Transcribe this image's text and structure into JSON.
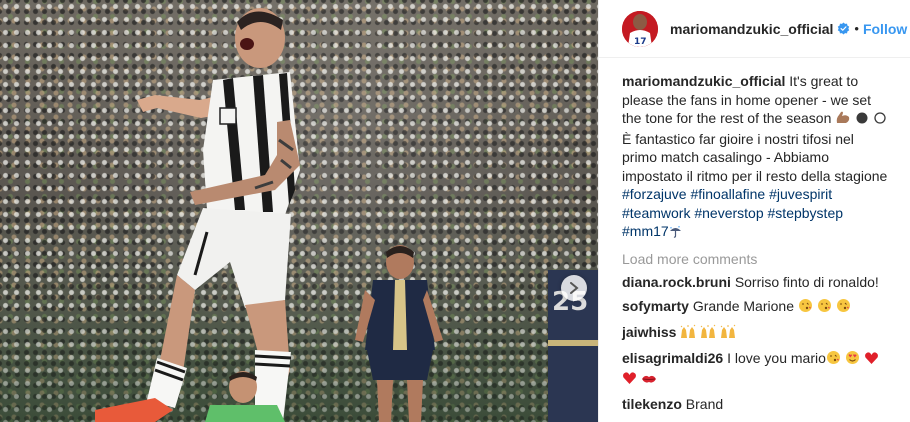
{
  "post": {
    "account": {
      "username": "mariomandzukic_official",
      "verified": true,
      "separator": "•",
      "follow_label": "Follow",
      "avatar_jersey_number": "17"
    },
    "photo": {
      "player_jersey_number": "25",
      "carousel_next_icon": "chevron-right-icon"
    },
    "caption": {
      "username": "mariomandzukic_official",
      "text_en": "It's great to please the fans in home opener - we set the tone for the rest of the season",
      "text_en_emojis": [
        "flexed-biceps",
        "black-circle",
        "white-circle"
      ],
      "text_it": "È fantastico far gioire i nostri tifosi nel primo match casalingo - Abbiamo impostato il ritmo per il resto della stagione",
      "hashtags_line1": "#forzajuve #finoallafine #juvespirit",
      "hashtags_line2": "#teamwork #neverstop #stepbystep",
      "hashtags_line3": "#mm17",
      "hashtags_line3_emoji": "umbrella-rain"
    },
    "load_more_label": "Load more comments",
    "comments": [
      {
        "username": "diana.rock.bruni",
        "text": "Sorriso finto di ronaldo!",
        "emojis": []
      },
      {
        "username": "sofymarty",
        "text": "Grande Marione",
        "emojis": [
          "kiss-face",
          "kiss-face",
          "kiss-face"
        ]
      },
      {
        "username": "jaiwhiss",
        "text": "",
        "emojis": [
          "raised-hands",
          "raised-hands",
          "raised-hands"
        ]
      },
      {
        "username": "elisagrimaldi26",
        "text": "I love you mario",
        "emojis": [
          "kiss-face",
          "heart-eyes",
          "red-heart",
          "red-heart",
          "kiss-mark"
        ]
      },
      {
        "username": "tilekenzo",
        "text": "Brand",
        "emojis": []
      }
    ],
    "colors": {
      "link_blue": "#3897f0",
      "hashtag_blue": "#003569",
      "muted_gray": "#999999",
      "text": "#262626",
      "juve_red": "#c41a22",
      "lazio_blue": "#1f2a44"
    }
  }
}
